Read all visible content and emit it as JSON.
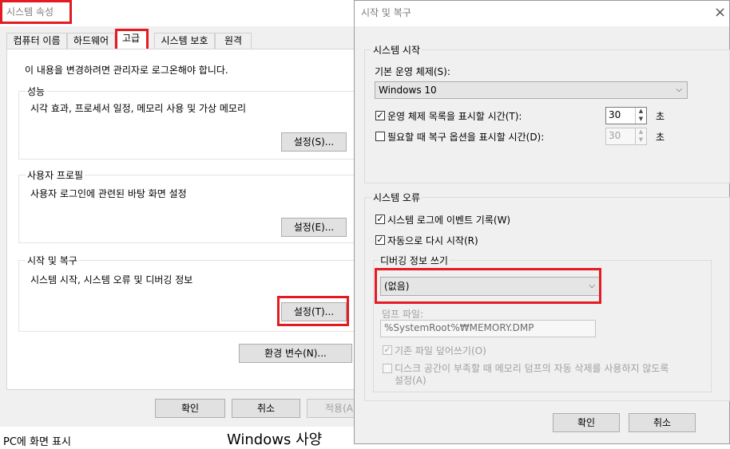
{
  "background_window": {
    "title": "시스템 속성",
    "tabs": [
      "컴퓨터 이름",
      "하드웨어",
      "고급",
      "시스템 보호",
      "원격"
    ],
    "admin_notice": "이 내용을 변경하려면 관리자로 로그온해야 합니다.",
    "performance": {
      "label": "성능",
      "description": "시각 효과, 프로세서 일정, 메모리 사용 및 가상 메모리",
      "button": "설정(S)..."
    },
    "user_profiles": {
      "label": "사용자 프로필",
      "description": "사용자 로그인에 관련된 바탕 화면 설정",
      "button": "설정(E)..."
    },
    "startup_recovery": {
      "label": "시작 및 복구",
      "description": "시스템 시작, 시스템 오류 및 디버깅 정보",
      "button": "설정(T)..."
    },
    "env_button": "환경 변수(N)...",
    "ok": "확인",
    "cancel": "취소",
    "apply": "적용(A"
  },
  "dialog": {
    "title": "시작 및 복구",
    "close_glyph": "×",
    "system_startup": {
      "label": "시스템 시작",
      "default_os_label": "기본 운영 체제(S):",
      "default_os_value": "Windows 10",
      "show_os_list_label": "운영 체제 목록을 표시할 시간(T):",
      "show_os_list_checked": true,
      "show_os_list_value": "30",
      "show_recovery_label": "필요할 때 복구 옵션을 표시할 시간(D):",
      "show_recovery_checked": false,
      "show_recovery_value": "30",
      "unit": "초"
    },
    "system_failure": {
      "label": "시스템 오류",
      "write_event_label": "시스템 로그에 이벤트 기록(W)",
      "write_event_checked": true,
      "auto_restart_label": "자동으로 다시 시작(R)",
      "auto_restart_checked": true,
      "debug_info_label": "디버깅 정보 쓰기",
      "debug_info_value": "(없음)",
      "dump_file_label": "덤프 파일:",
      "dump_file_value": "%SystemRoot%₩MEMORY.DMP",
      "overwrite_label": "기존 파일 덮어쓰기(O)",
      "overwrite_checked": true,
      "disable_autodelete_label_1": "디스크 공간이 부족할 때 메모리 덤프의 자동 삭제를 사용하지 않도록",
      "disable_autodelete_label_2": "설정(A)",
      "disable_autodelete_checked": false
    },
    "ok": "확인",
    "cancel": "취소"
  },
  "underlay": {
    "left_text": "PC에 화면 표시",
    "right_text": "Windows 사양"
  },
  "icons": {
    "checkmark": "✓",
    "dropdown": "⌵",
    "spin_up": "▲",
    "spin_down": "▼"
  },
  "colors": {
    "highlight": "#e31b23",
    "window_bg": "#f0f0f0",
    "button_bg": "#e1e1e1"
  }
}
